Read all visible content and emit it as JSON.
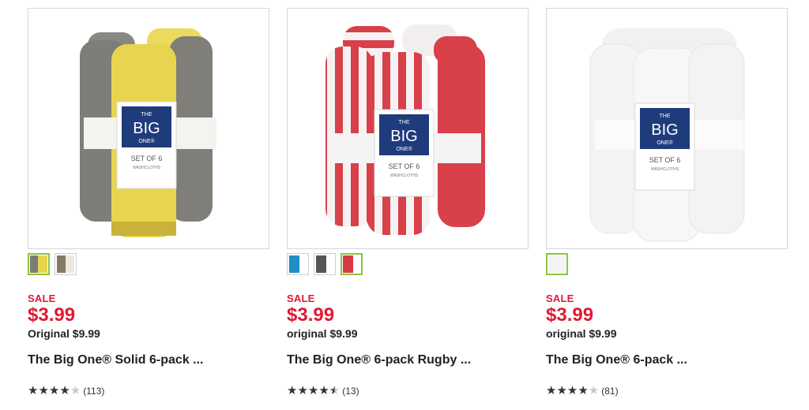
{
  "products": [
    {
      "swatches": [
        {
          "color_a": "#7d7b76",
          "color_b": "#e8d44d",
          "selected": true
        },
        {
          "color_a": "#857a64",
          "color_b": "#ece8dc",
          "selected": false
        }
      ],
      "sale_label": "SALE",
      "sale_price": "$3.99",
      "original_price": "Original $9.99",
      "title": "The Big One® Solid 6-pack ...",
      "rating": 4,
      "rating_text": "★★★★",
      "rating_empty_text": "★",
      "review_count": "(113)",
      "package_label": {
        "line1": "THE",
        "line2": "BIG",
        "line3": "ONE®",
        "line4": "SET OF 6",
        "line5": "WASHCLOTHS"
      }
    },
    {
      "swatches": [
        {
          "color_a": "#1f8fc4",
          "color_b": "#ffffff",
          "selected": false
        },
        {
          "color_a": "#555555",
          "color_b": "#ffffff",
          "selected": false
        },
        {
          "color_a": "#d63a45",
          "color_b": "#ffffff",
          "selected": true
        }
      ],
      "sale_label": "SALE",
      "sale_price": "$3.99",
      "original_price": "original $9.99",
      "title": "The Big One® 6-pack Rugby ...",
      "rating": 4.5,
      "rating_text": "★★★★",
      "rating_empty_text": "★",
      "review_count": "(13)",
      "package_label": {
        "line1": "THE",
        "line2": "BIG",
        "line3": "ONE®",
        "line4": "SET OF 6",
        "line5": "WASHCLOTHS"
      }
    },
    {
      "swatches": [
        {
          "color_a": "#f4f4f4",
          "color_b": "#ffffff",
          "selected": true
        }
      ],
      "sale_label": "SALE",
      "sale_price": "$3.99",
      "original_price": "original $9.99",
      "title": "The Big One® 6-pack ...",
      "rating": 4,
      "rating_text": "★★★★",
      "rating_empty_text": "★",
      "review_count": "(81)",
      "package_label": {
        "line1": "THE",
        "line2": "BIG",
        "line3": "ONE®",
        "line4": "SET OF 6",
        "line5": "WASHCLOTHS"
      }
    }
  ]
}
